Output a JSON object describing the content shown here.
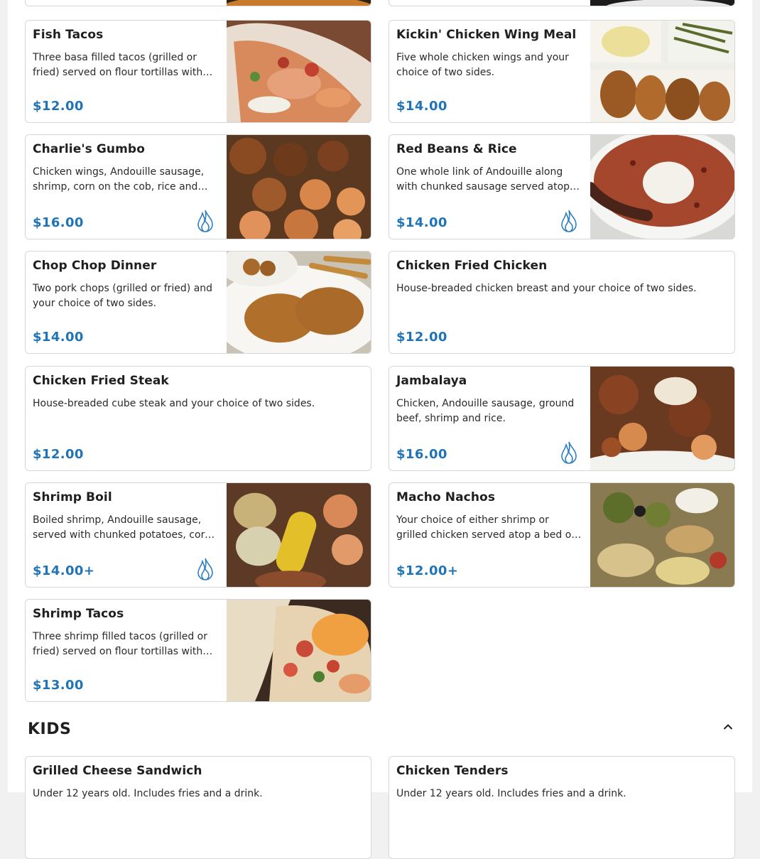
{
  "menu": {
    "items": [
      {
        "title": "Fish Tacos",
        "desc": "Three basa filled tacos (grilled or fried) served on flour tortillas with cabbage, pico de gallo and house sauce.",
        "price": "$12.00",
        "spicy": false,
        "image": "fish-tacos-photo"
      },
      {
        "title": "Kickin' Chicken Wing Meal",
        "desc": "Five whole chicken wings and your choice of two sides.",
        "price": "$14.00",
        "spicy": false,
        "image": "chicken-wing-meal-photo"
      },
      {
        "title": "Charlie's Gumbo",
        "desc": "Chicken wings, Andouille sausage, shrimp, corn on the cob, rice and okra in a dark roux gumbo.",
        "price": "$16.00",
        "spicy": true,
        "image": "gumbo-photo"
      },
      {
        "title": "Red Beans & Rice",
        "desc": "One whole link of Andouille along with chunked sausage served atop red beans and rice.",
        "price": "$14.00",
        "spicy": true,
        "image": "red-beans-rice-photo"
      },
      {
        "title": "Chop Chop Dinner",
        "desc": "Two pork chops (grilled or fried) and your choice of two sides.",
        "price": "$14.00",
        "spicy": false,
        "image": "pork-chops-photo"
      },
      {
        "title": "Chicken Fried Chicken",
        "desc": "House-breaded chicken breast and your choice of two sides.",
        "price": "$12.00",
        "spicy": false,
        "image": null
      },
      {
        "title": "Chicken Fried Steak",
        "desc": "House-breaded cube steak and your choice of two sides.",
        "price": "$12.00",
        "spicy": false,
        "image": null
      },
      {
        "title": "Jambalaya",
        "desc": "Chicken, Andouille sausage, ground beef, shrimp and rice.",
        "price": "$16.00",
        "spicy": true,
        "image": "jambalaya-photo"
      },
      {
        "title": "Shrimp Boil",
        "desc": "Boiled shrimp, Andouille sausage, served with chunked potatoes, corn on the cob and our house seasoning.",
        "price": "$14.00+",
        "spicy": true,
        "image": "shrimp-boil-photo"
      },
      {
        "title": "Macho Nachos",
        "desc": "Your choice of either shrimp or grilled chicken served atop a bed of tortilla chips with cheese, jalapenos and sour cream.",
        "price": "$12.00+",
        "spicy": false,
        "image": "nachos-photo"
      },
      {
        "title": "Shrimp Tacos",
        "desc": "Three shrimp filled tacos (grilled or fried) served on flour tortillas with cabbage, pico de gallo and house sauce.",
        "price": "$13.00",
        "spicy": false,
        "image": "shrimp-tacos-photo"
      }
    ]
  },
  "kids": {
    "section_title": "KIDS",
    "items": [
      {
        "title": "Grilled Cheese Sandwich",
        "desc": "Under 12 years old. Includes fries and a drink."
      },
      {
        "title": "Chicken Tenders",
        "desc": "Under 12 years old. Includes fries and a drink."
      }
    ]
  },
  "colors": {
    "price": "#1f74b8",
    "spicy_icon": "#2f7fc0",
    "border": "#d7d7d7"
  },
  "icons": {
    "spicy": "flame-icon",
    "collapse": "chevron-up-icon"
  }
}
